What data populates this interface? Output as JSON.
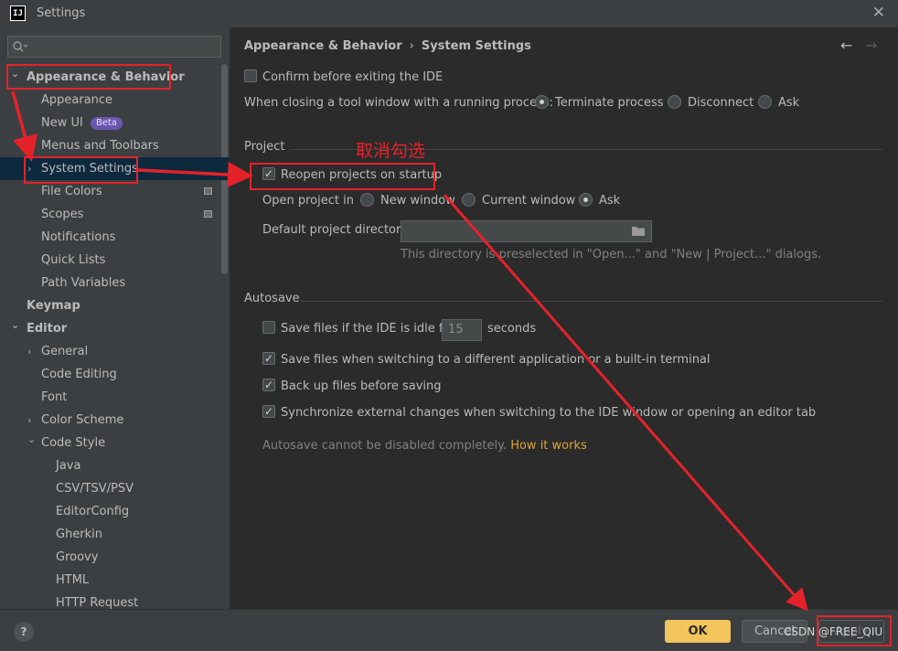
{
  "window": {
    "logo_text": "IJ",
    "title": "Settings"
  },
  "search": {
    "placeholder": ""
  },
  "sidebar": {
    "items": [
      {
        "label": "Appearance & Behavior",
        "level": 0,
        "bold": true,
        "chevron": "expanded",
        "selected": false
      },
      {
        "label": "Appearance",
        "level": 1,
        "bold": false,
        "chevron": "none",
        "selected": false
      },
      {
        "label": "New UI",
        "level": 1,
        "bold": false,
        "chevron": "none",
        "selected": false,
        "badge": "Beta"
      },
      {
        "label": "Menus and Toolbars",
        "level": 1,
        "bold": false,
        "chevron": "none",
        "selected": false
      },
      {
        "label": "System Settings",
        "level": 1,
        "bold": false,
        "chevron": "collapsed",
        "selected": true
      },
      {
        "label": "File Colors",
        "level": 1,
        "bold": false,
        "chevron": "none",
        "selected": false,
        "project_icon": true
      },
      {
        "label": "Scopes",
        "level": 1,
        "bold": false,
        "chevron": "none",
        "selected": false,
        "project_icon": true
      },
      {
        "label": "Notifications",
        "level": 1,
        "bold": false,
        "chevron": "none",
        "selected": false
      },
      {
        "label": "Quick Lists",
        "level": 1,
        "bold": false,
        "chevron": "none",
        "selected": false
      },
      {
        "label": "Path Variables",
        "level": 1,
        "bold": false,
        "chevron": "none",
        "selected": false
      },
      {
        "label": "Keymap",
        "level": 0,
        "bold": true,
        "chevron": "none",
        "selected": false
      },
      {
        "label": "Editor",
        "level": 0,
        "bold": true,
        "chevron": "expanded",
        "selected": false
      },
      {
        "label": "General",
        "level": 1,
        "bold": false,
        "chevron": "collapsed",
        "selected": false
      },
      {
        "label": "Code Editing",
        "level": 1,
        "bold": false,
        "chevron": "none",
        "selected": false
      },
      {
        "label": "Font",
        "level": 1,
        "bold": false,
        "chevron": "none",
        "selected": false
      },
      {
        "label": "Color Scheme",
        "level": 1,
        "bold": false,
        "chevron": "collapsed",
        "selected": false
      },
      {
        "label": "Code Style",
        "level": 1,
        "bold": false,
        "chevron": "expanded",
        "selected": false
      },
      {
        "label": "Java",
        "level": 2,
        "bold": false,
        "chevron": "none",
        "selected": false
      },
      {
        "label": "CSV/TSV/PSV",
        "level": 2,
        "bold": false,
        "chevron": "none",
        "selected": false
      },
      {
        "label": "EditorConfig",
        "level": 2,
        "bold": false,
        "chevron": "none",
        "selected": false
      },
      {
        "label": "Gherkin",
        "level": 2,
        "bold": false,
        "chevron": "none",
        "selected": false
      },
      {
        "label": "Groovy",
        "level": 2,
        "bold": false,
        "chevron": "none",
        "selected": false
      },
      {
        "label": "HTML",
        "level": 2,
        "bold": false,
        "chevron": "none",
        "selected": false
      },
      {
        "label": "HTTP Request",
        "level": 2,
        "bold": false,
        "chevron": "none",
        "selected": false
      }
    ]
  },
  "breadcrumb": {
    "parent": "Appearance & Behavior",
    "separator": "›",
    "current": "System Settings",
    "back_icon": "←",
    "forward_icon": "→"
  },
  "general": {
    "confirm_exit": {
      "label": "Confirm before exiting the IDE",
      "checked": false
    },
    "closing_label": "When closing a tool window with a running process:",
    "closing_options": [
      {
        "label": "Terminate process",
        "selected": true
      },
      {
        "label": "Disconnect",
        "selected": false
      },
      {
        "label": "Ask",
        "selected": false
      }
    ]
  },
  "project": {
    "title": "Project",
    "reopen": {
      "label": "Reopen projects on startup",
      "checked": true
    },
    "open_in_label": "Open project in",
    "open_in_options": [
      {
        "label": "New window",
        "selected": false
      },
      {
        "label": "Current window",
        "selected": false
      },
      {
        "label": "Ask",
        "selected": true
      }
    ],
    "default_dir_label": "Default project directory:",
    "default_dir_value": "",
    "default_dir_hint": "This directory is preselected in \"Open...\" and \"New | Project...\" dialogs."
  },
  "autosave": {
    "title": "Autosave",
    "idle": {
      "label_before": "Save files if the IDE is idle for",
      "value": "15",
      "label_after": "seconds",
      "checked": false
    },
    "switching": {
      "label": "Save files when switching to a different application or a built-in terminal",
      "checked": true
    },
    "backup": {
      "label": "Back up files before saving",
      "checked": true
    },
    "sync": {
      "label": "Synchronize external changes when switching to the IDE window or opening an editor tab",
      "checked": true
    },
    "note": "Autosave cannot be disabled completely.",
    "link": "How it works"
  },
  "footer": {
    "help": "?",
    "ok": "OK",
    "cancel": "Cancel",
    "apply": "Apply"
  },
  "annotation": {
    "text": "取消勾选",
    "color": "#e5222a"
  },
  "watermark": "CSDN @FREE_QIU"
}
